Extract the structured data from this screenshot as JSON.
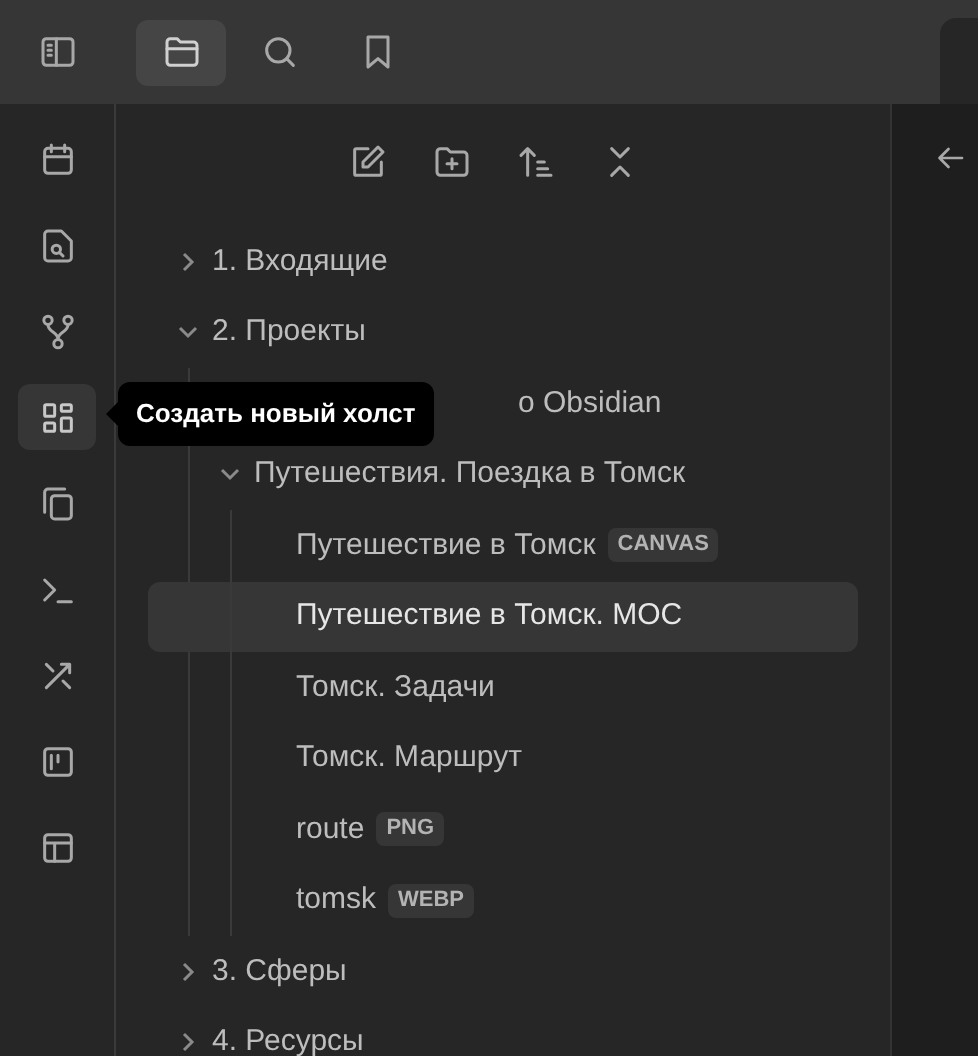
{
  "top_tabs": [
    {
      "kind": "files",
      "selected": true
    },
    {
      "kind": "search",
      "selected": false
    },
    {
      "kind": "bookmarks",
      "selected": false
    }
  ],
  "ribbon": [
    {
      "kind": "calendar",
      "selected": false
    },
    {
      "kind": "file-search",
      "selected": false
    },
    {
      "kind": "graph",
      "selected": false
    },
    {
      "kind": "canvas",
      "selected": true
    },
    {
      "kind": "copy",
      "selected": false
    },
    {
      "kind": "terminal",
      "selected": false
    },
    {
      "kind": "tools",
      "selected": false
    },
    {
      "kind": "kanban",
      "selected": false
    },
    {
      "kind": "layout",
      "selected": false
    }
  ],
  "tooltip": "Создать новый холст",
  "tree": [
    {
      "label": "1. Входящие",
      "kind": "folder",
      "expanded": false,
      "selected": false
    },
    {
      "label": "2. Проекты",
      "kind": "folder",
      "expanded": true,
      "selected": false,
      "children": [
        {
          "label": "о Obsidian",
          "kind": "covered",
          "selected": false
        },
        {
          "label": "Путешествия. Поездка в Томск",
          "kind": "folder",
          "expanded": true,
          "selected": false,
          "children": [
            {
              "label": "Путешествие в Томск",
              "kind": "file",
              "badge": "CANVAS",
              "selected": false
            },
            {
              "label": "Путешествие в Томск. MOC",
              "kind": "file",
              "selected": true
            },
            {
              "label": "Томск. Задачи",
              "kind": "file",
              "selected": false
            },
            {
              "label": "Томск. Маршрут",
              "kind": "file",
              "selected": false
            },
            {
              "label": "route",
              "kind": "file",
              "badge": "PNG",
              "selected": false
            },
            {
              "label": "tomsk",
              "kind": "file",
              "badge": "WEBP",
              "selected": false
            }
          ]
        }
      ]
    },
    {
      "label": "3. Сферы",
      "kind": "folder",
      "expanded": false,
      "selected": false
    },
    {
      "label": "4. Ресурсы",
      "kind": "folder",
      "expanded": false,
      "selected": false
    }
  ]
}
